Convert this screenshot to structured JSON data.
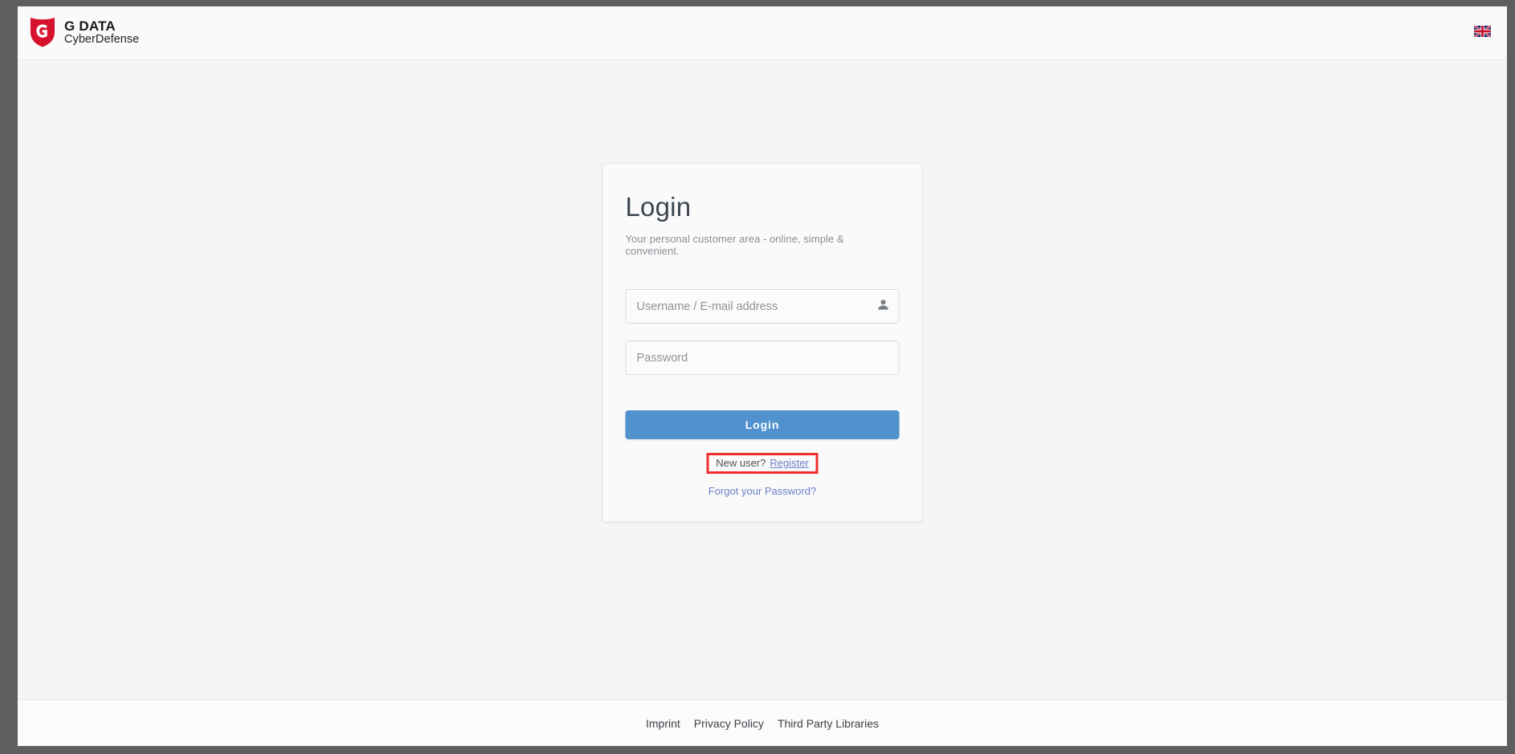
{
  "header": {
    "brand": {
      "title": "G DATA",
      "subtitle": "CyberDefense",
      "shield_icon": "gdata-shield-icon",
      "shield_color": "#D7122C"
    },
    "language": {
      "icon": "uk-flag-icon",
      "selected": "English"
    }
  },
  "login_card": {
    "title": "Login",
    "subtitle": "Your personal customer area - online, simple & convenient.",
    "username_field": {
      "placeholder": "Username / E-mail address",
      "value": "",
      "icon": "person-icon"
    },
    "password_field": {
      "placeholder": "Password",
      "value": ""
    },
    "submit_label": "Login",
    "submit_color": "#5091CE",
    "register_prompt": "New user?",
    "register_link": "Register",
    "forgot_link": "Forgot your Password?",
    "link_color": "#6B7FC7",
    "annotation_color": "#F22F2F"
  },
  "footer": {
    "links": [
      {
        "label": "Imprint"
      },
      {
        "label": "Privacy Policy"
      },
      {
        "label": "Third Party Libraries"
      }
    ]
  }
}
